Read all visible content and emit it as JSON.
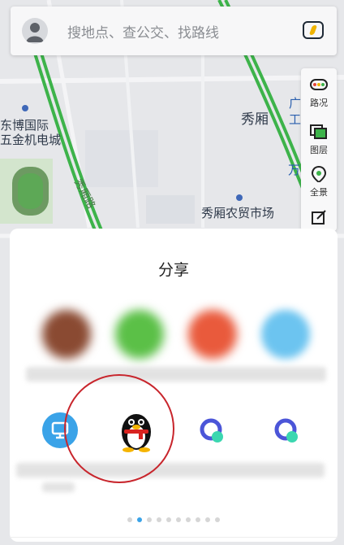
{
  "search": {
    "placeholder": "搜地点、查公交、找路线"
  },
  "map_labels": {
    "east_expo": "东博国际",
    "hardware_city": "五金机电城",
    "xiuxiang": "秀厢",
    "market": "秀厢农贸市场",
    "road_label": "秀厢路",
    "edge_guang": "广",
    "edge_gong": "工",
    "edge_wan": "万"
  },
  "toolbar": {
    "traffic": "路况",
    "layers": "图层",
    "panorama": "全景"
  },
  "share": {
    "title": "分享",
    "page_count": 10,
    "active_page": 1
  },
  "colors": {
    "road_green": "#3db34a",
    "accent_blue": "#3aa3e8",
    "highlight_red": "#c8252c"
  }
}
